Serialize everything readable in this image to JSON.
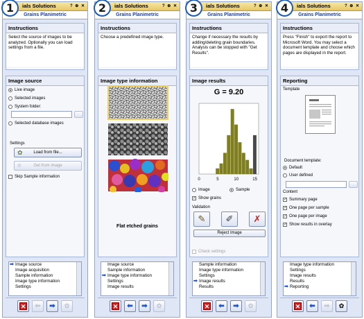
{
  "panels": [
    {
      "step": "1",
      "title": "ials Solutions",
      "title_buttons": "? ⊕ ✕",
      "subtitle": "Grains Planimetric",
      "instructions_heading": "Instructions",
      "instructions_text": "Select the source of images to be analyzed. Optionally you can load settings from a file.",
      "section_heading": "Image source",
      "radios": [
        "Live image",
        "Selected images",
        "System folder:",
        "Selected database images"
      ],
      "settings_label": "Settings",
      "load_button": "Load from file...",
      "get_button": "Get from image",
      "skip_label": "Skip Sample information",
      "list": [
        "Image source",
        "Image acquisition",
        "Sample information",
        "Image type information",
        "Settings"
      ],
      "list_current": 0
    },
    {
      "step": "2",
      "title": "ials Solutions",
      "title_buttons": "? ⊕ ✕",
      "subtitle": "Grains Planimetric",
      "instructions_heading": "Instructions",
      "instructions_text": "Choose a predefined image type.",
      "section_heading": "Image type information",
      "caption": "Flat etched grains",
      "list": [
        "Image source",
        "Sample information",
        "Image type information",
        "Settings",
        "Image results"
      ],
      "list_current": 2
    },
    {
      "step": "3",
      "title": "ials Solutions",
      "title_buttons": "? ⊕ ✕",
      "subtitle": "Grains Planimetric",
      "instructions_heading": "Instructions",
      "instructions_text": "Change if necessary the results by adding/deleting grain boundaries. Analysis can be stopped with \"Get Results\".",
      "section_heading": "Image results",
      "g_value": "G = 9.20",
      "radio_image": "Image",
      "radio_sample": "Sample",
      "show_grains": "Show grains",
      "validation": "Validation",
      "reject_button": "Reject Image",
      "check_settings": "Check settings",
      "list": [
        "Sample information",
        "Image type information",
        "Settings",
        "Image results",
        "Results"
      ],
      "list_current": 3
    },
    {
      "step": "4",
      "title": "ials Solutions",
      "title_buttons": "? ⊕ ✕",
      "subtitle": "Grains Planimetric",
      "instructions_heading": "Instructions",
      "instructions_text": "Press \"Finish\" to export the report to Microsoft Word. You may select a document template and choose which pages are displayed in the report.",
      "section_heading": "Reporting",
      "template_label": "Template",
      "doc_template_label": "Document template:",
      "radio_default": "Default",
      "radio_user": "User defined",
      "content_label": "Content",
      "content_items": [
        "Summary page",
        "One page per sample",
        "One page per image",
        "Show results in overlay"
      ],
      "list": [
        "Image type information",
        "Settings",
        "Image results",
        "Results",
        "Reporting"
      ],
      "list_current": 4
    }
  ],
  "chart_data": {
    "type": "bar",
    "x": [
      5,
      6,
      7,
      8,
      9,
      10,
      11,
      12,
      13,
      14,
      15
    ],
    "values": [
      0.08,
      0.15,
      0.3,
      0.55,
      0.92,
      0.7,
      0.45,
      0.3,
      0.2,
      0.08,
      0.55
    ],
    "xticks": [
      "0",
      "5",
      "10",
      "15"
    ],
    "xlim": [
      0,
      16
    ],
    "bar_color": "#7f7f1f",
    "last_bar_color": "#4a4a4a"
  },
  "colors": {
    "accent": "#1e5cb3",
    "title_gradient": "#e7c767",
    "panel_bg": "#dfe6f5"
  }
}
